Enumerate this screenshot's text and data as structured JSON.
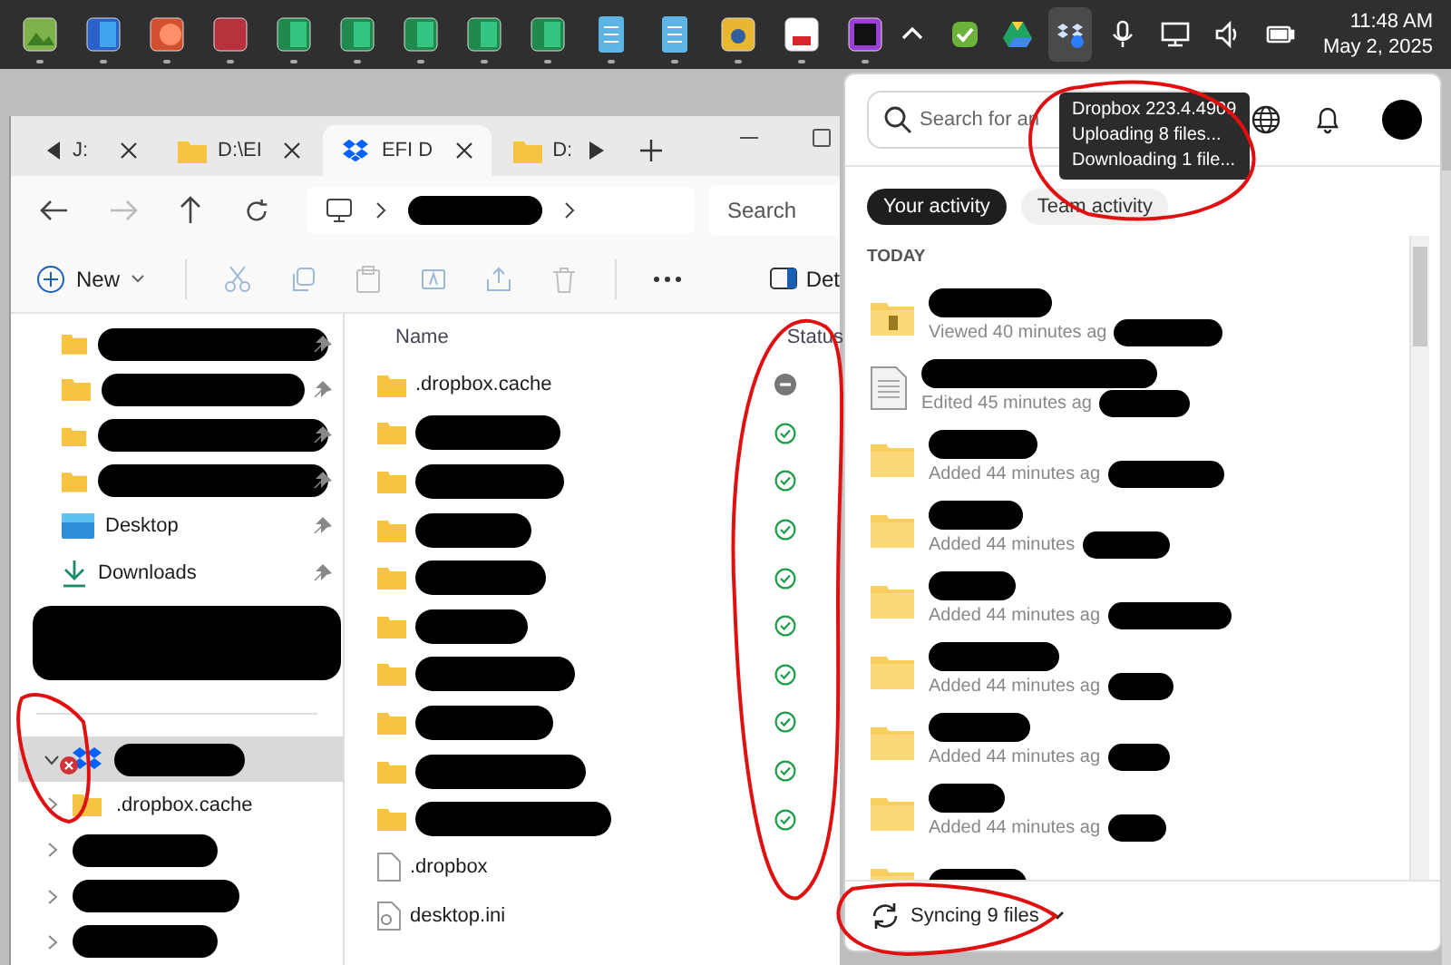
{
  "taskbar": {
    "apps": [
      {
        "kind": "photo"
      },
      {
        "kind": "word"
      },
      {
        "kind": "slides"
      },
      {
        "kind": "database"
      },
      {
        "kind": "sheet"
      },
      {
        "kind": "sheet"
      },
      {
        "kind": "sheet"
      },
      {
        "kind": "sheet"
      },
      {
        "kind": "sheet"
      },
      {
        "kind": "notepad"
      },
      {
        "kind": "notepad"
      },
      {
        "kind": "lock"
      },
      {
        "kind": "pdf"
      },
      {
        "kind": "ide"
      }
    ],
    "tray": [
      {
        "kind": "chevron",
        "selected": false
      },
      {
        "kind": "shield",
        "selected": false
      },
      {
        "kind": "drive",
        "selected": false
      },
      {
        "kind": "dropbox",
        "selected": true
      },
      {
        "kind": "mic",
        "selected": false
      },
      {
        "kind": "monitor",
        "selected": false
      },
      {
        "kind": "speaker",
        "selected": false
      },
      {
        "kind": "battery",
        "selected": false
      }
    ],
    "time": "11:48 AM",
    "date": "May 2, 2025"
  },
  "explorer": {
    "tabs": [
      {
        "label": "J:",
        "kind": "plain",
        "selected": false
      },
      {
        "label": "D:\\EI",
        "kind": "folder",
        "selected": false
      },
      {
        "label": "EFI D",
        "kind": "dropbox",
        "selected": true
      },
      {
        "label": "D:",
        "kind": "folder",
        "selected": false
      }
    ],
    "search": {
      "placeholder": "Search"
    },
    "new_label": "New",
    "details_label": "Det",
    "nav": [
      {
        "kind": "redacted"
      },
      {
        "kind": "redacted"
      },
      {
        "kind": "redacted"
      },
      {
        "kind": "redacted"
      },
      {
        "kind": "desktop",
        "label": "Desktop"
      },
      {
        "kind": "downloads",
        "label": "Downloads"
      },
      {
        "kind": "block"
      },
      {
        "kind": "divider"
      },
      {
        "kind": "root",
        "expanded": true,
        "error": true,
        "selected": true
      },
      {
        "kind": "child",
        "label": ".dropbox.cache"
      },
      {
        "kind": "hidden"
      },
      {
        "kind": "hidden"
      },
      {
        "kind": "hidden"
      }
    ],
    "columns": [
      "Name",
      "Status"
    ],
    "files": [
      {
        "name": ".dropbox.cache",
        "kind": "excluded"
      },
      {
        "kind": "synced"
      },
      {
        "kind": "synced"
      },
      {
        "kind": "synced"
      },
      {
        "kind": "synced"
      },
      {
        "kind": "synced"
      },
      {
        "kind": "synced"
      },
      {
        "kind": "synced"
      },
      {
        "kind": "synced"
      },
      {
        "kind": "synced"
      },
      {
        "name": ".dropbox",
        "kind": "file"
      },
      {
        "name": "desktop.ini",
        "kind": "config"
      }
    ]
  },
  "dropbox": {
    "search": {
      "placeholder": "Search for an"
    },
    "tooltip": [
      "Dropbox 223.4.4909",
      "Uploading 8 files...",
      "Downloading 1 file..."
    ],
    "tabs": [
      {
        "label": "Your activity",
        "selected": true
      },
      {
        "label": "Team activity",
        "selected": false
      }
    ],
    "section": "TODAY",
    "activity": [
      {
        "kind": "project",
        "detail": "Viewed 40 minutes ag"
      },
      {
        "kind": "document",
        "detail": "Edited 45 minutes ag"
      },
      {
        "kind": "folder",
        "detail": "Added 44 minutes ag"
      },
      {
        "kind": "folder",
        "detail": "Added 44 minutes"
      },
      {
        "kind": "folder",
        "detail": "Added 44 minutes ag"
      },
      {
        "kind": "folder",
        "detail": "Added 44 minutes ag"
      },
      {
        "kind": "folder",
        "detail": "Added 44 minutes ag"
      },
      {
        "kind": "folder",
        "detail": "Added 44 minutes ag"
      },
      {
        "kind": "folder"
      }
    ],
    "sync_status": "Syncing 9 files"
  }
}
